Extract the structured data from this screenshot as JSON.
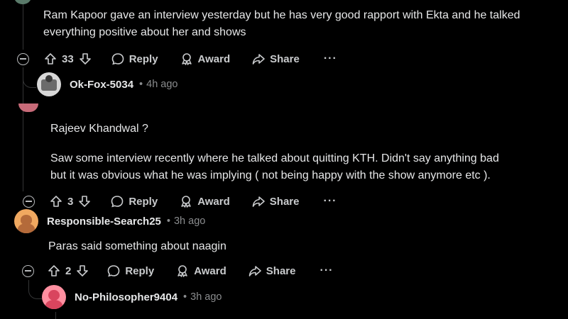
{
  "comments": [
    {
      "body": "Ram Kapoor gave an interview yesterday but he has very good rapport with Ekta and he talked everything positive about her and shows",
      "score": "33",
      "actions": {
        "reply": "Reply",
        "award": "Award",
        "share": "Share",
        "more": "···"
      }
    },
    {
      "username": "Ok-Fox-5034",
      "time": "4h ago",
      "separator": "•"
    },
    {
      "body_line1": "Rajeev Khandwal ?",
      "body_line2": "Saw some interview recently where he talked about quitting KTH. Didn't say anything bad",
      "body_line3": "but it was obvious what he was implying ( not being happy with the show anymore etc ).",
      "score": "3",
      "actions": {
        "reply": "Reply",
        "award": "Award",
        "share": "Share",
        "more": "···"
      }
    },
    {
      "username": "Responsible-Search25",
      "time": "3h ago",
      "separator": "•",
      "body": "Paras said something about naagin",
      "score": "2",
      "actions": {
        "reply": "Reply",
        "award": "Award",
        "share": "Share",
        "more": "···"
      }
    },
    {
      "username": "No-Philosopher9404",
      "time": "3h ago",
      "separator": "•"
    }
  ],
  "colors": {
    "background": "#000000",
    "text": "#e6e7e8",
    "muted": "#8a8c8e",
    "thread_line": "#343536",
    "avatar_orange": "#f0a860",
    "avatar_pink": "#ff8fa0"
  }
}
